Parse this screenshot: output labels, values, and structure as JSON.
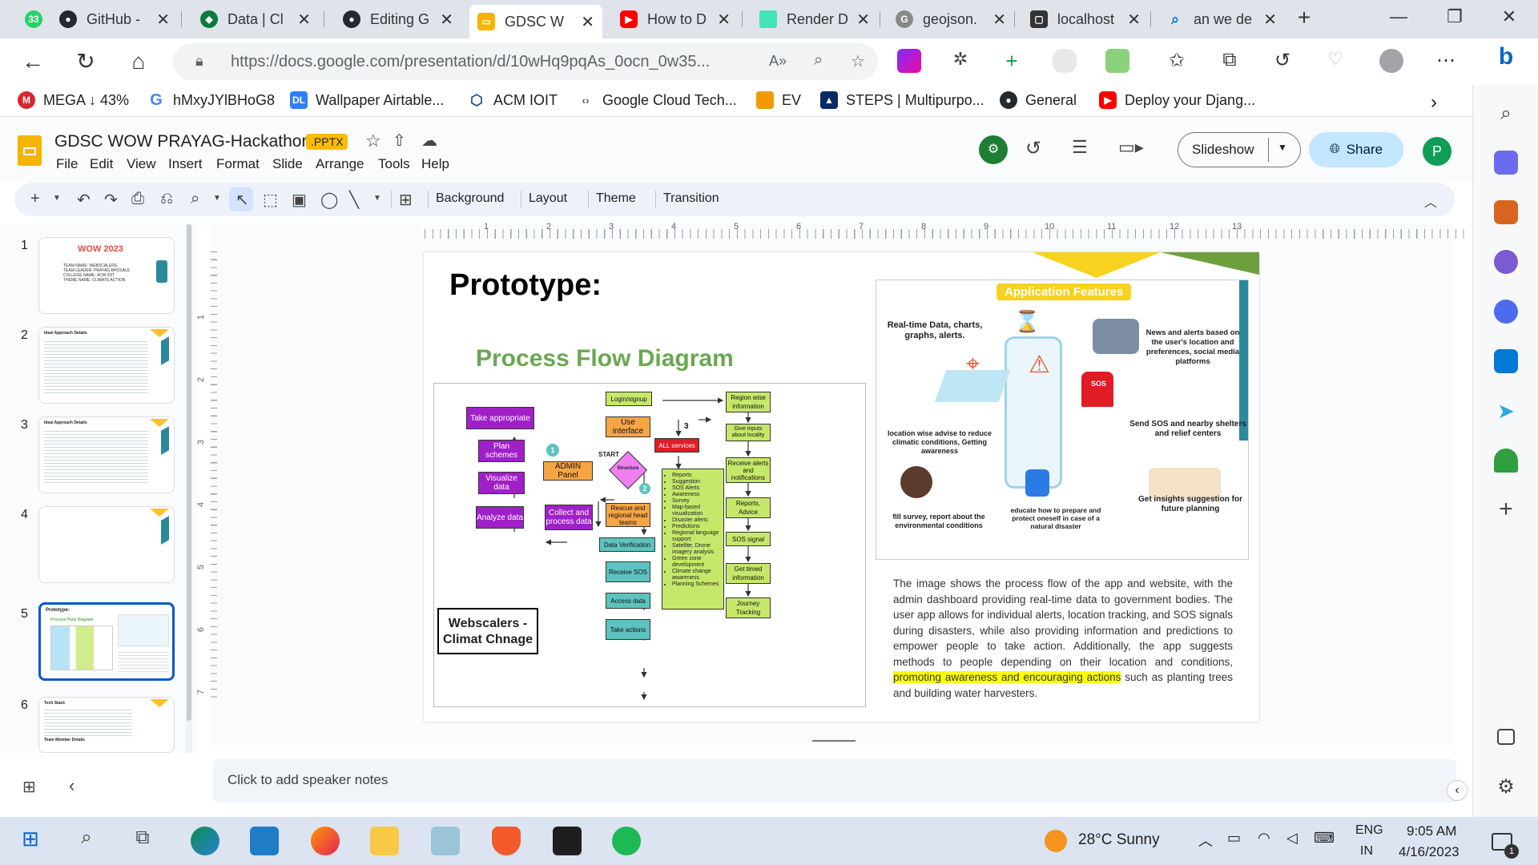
{
  "browser": {
    "tabs": [
      {
        "label": "33",
        "icon": "whatsapp-icon",
        "color": "#25d366"
      },
      {
        "label": "GitHub -",
        "icon": "github-icon",
        "color": "#24292f"
      },
      {
        "label": "Data | Cl",
        "icon": "dataset-icon",
        "color": "#0b7a3e"
      },
      {
        "label": "Editing G",
        "icon": "github-icon",
        "color": "#24292f"
      },
      {
        "label": "GDSC W",
        "icon": "slides-icon",
        "color": "#f4b400"
      },
      {
        "label": "How to D",
        "icon": "youtube-icon",
        "color": "#ff0000"
      },
      {
        "label": "Render D",
        "icon": "render-icon",
        "color": "#46e3b7"
      },
      {
        "label": "geojson.",
        "icon": "geojson-icon",
        "color": "#888888"
      },
      {
        "label": "localhost",
        "icon": "localhost-icon",
        "color": "#333333"
      },
      {
        "label": "an we de",
        "icon": "bing-search-icon",
        "color": "#0078d4"
      }
    ],
    "url": "https://docs.google.com/presentation/d/10wHq9pqAs_0ocn_0w35...",
    "bookmarks": [
      {
        "label": "MEGA ↓ 43%",
        "icon": "mega-icon",
        "color": "#d9272e"
      },
      {
        "label": "hMxyJYlBHoG8",
        "icon": "google-icon",
        "color": "#4285f4"
      },
      {
        "label": "Wallpaper Airtable...",
        "icon": "airtable-icon",
        "color": "#2d7ff9"
      },
      {
        "label": "ACM IOIT",
        "icon": "acm-icon",
        "color": "#1d4e89"
      },
      {
        "label": "Google Cloud Tech...",
        "icon": "gdsc-icon",
        "color": "#5f6368"
      },
      {
        "label": "EV",
        "icon": "ev-icon",
        "color": "#f29900"
      },
      {
        "label": "STEPS | Multipurpo...",
        "icon": "steps-icon",
        "color": "#0a2a66"
      },
      {
        "label": "General",
        "icon": "github-icon",
        "color": "#24292f"
      },
      {
        "label": "Deploy your Djang...",
        "icon": "youtube-icon",
        "color": "#ff0000"
      }
    ]
  },
  "slides_app": {
    "title": "GDSC WOW PRAYAG-Hackathon",
    "badge": ".PPTX",
    "menus": [
      "File",
      "Edit",
      "View",
      "Insert",
      "Format",
      "Slide",
      "Arrange",
      "Tools",
      "Help"
    ],
    "slideshow_label": "Slideshow",
    "share_label": "Share",
    "avatar_initial": "P",
    "toolbar_items": [
      "Background",
      "Layout",
      "Theme",
      "Transition"
    ],
    "speaker_notes_placeholder": "Click to add speaker notes",
    "ruler_h": [
      "1",
      "2",
      "3",
      "4",
      "5",
      "6",
      "7",
      "8",
      "9",
      "10",
      "11",
      "12",
      "13"
    ],
    "ruler_v": [
      "1",
      "2",
      "3",
      "4",
      "5",
      "6",
      "7"
    ]
  },
  "filmstrip": {
    "slides": [
      {
        "number": "1",
        "texts": [
          "WOW 2023",
          "TEAM NAME: WEBSCALERS",
          "TEAM LEADER: PRAYAG BHOSALE",
          "COLLEGE NAME: ACM IOIT",
          "THEME NAME: CLIMATE ACTION"
        ]
      },
      {
        "number": "2",
        "texts": [
          "Idea/ Approach Details"
        ]
      },
      {
        "number": "3",
        "texts": [
          "Idea/ Approach Details"
        ]
      },
      {
        "number": "4",
        "texts": []
      },
      {
        "number": "5",
        "texts": [
          "Prototype:",
          "Process Flow Diagram"
        ]
      },
      {
        "number": "6",
        "texts": [
          "Tech Stack",
          "Team Member Details"
        ]
      }
    ],
    "selected": "5"
  },
  "slide": {
    "heading": "Prototype:",
    "subheading": "Process Flow Diagram",
    "team_box": [
      "Webscalers -",
      "Climat Chnage"
    ],
    "flow": {
      "take_appropriate": "Take appropriate",
      "plan_schemes": "Plan schemes",
      "visualize_data": "Visualize data",
      "analyze_data": "Analyze data",
      "collect_process": "Collect and process data",
      "admin_panel": "ADMIN Panel",
      "login": "Login/signup",
      "use_interface": "Use interface",
      "start": "START",
      "structure": "Structure",
      "rescue": "Rescue and regional head teams",
      "data_verification": "Data Verification",
      "receive_sos": "Receive SOS",
      "access_data": "Access data",
      "take_actions": "Take actions",
      "all_services": "ALL services",
      "services_list": [
        "Reports",
        "Suggestion",
        "SOS Alerts",
        "Awareness",
        "Survey",
        "Map-based visualization",
        "Disaster alerts",
        "Predictions",
        "Regional language support",
        "Satellite, Drone imagery analysis",
        "Green zone development",
        "Climate change awareness",
        "Planning Schemes"
      ],
      "region_info": "Region wise information",
      "give_inputs": "Give inputs about locality",
      "receive_alerts": "Receive alerts and notifications",
      "reports_advice": "Reports, Advice",
      "sos_signal": "SOS signal",
      "timed_info": "Get timed information",
      "journey": "Journey Tracking",
      "markers": [
        "1",
        "2",
        "3"
      ]
    },
    "features": {
      "title": "Application Features",
      "realtime": "Real-time Data, charts, graphs, alerts.",
      "news": "News and alerts based on the user's location and preferences, social media platforms",
      "location": "location wise advise to reduce climatic conditions, Getting awareness",
      "sos": "Send SOS and nearby shelters and relief centers",
      "sos_badge": "SOS",
      "survey": "fill survey, report about the environmental conditions",
      "educate": "educate how to prepare and protect oneself in case of a natural disaster",
      "insights": "Get insights suggestion for future planning"
    },
    "description_before": "The image shows the process flow of the app and website, with the admin dashboard providing real-time data to government bodies. The user app allows for individual alerts, location tracking, and SOS signals during disasters, while also providing information and predictions to empower people to take action. Additionally, the app suggests methods to people depending on their location and conditions,",
    "description_highlight": "promoting awareness and encouraging actions",
    "description_after": "such as planting trees and building water harvesters."
  },
  "taskbar": {
    "weather": "28°C  Sunny",
    "lang_top": "ENG",
    "lang_bottom": "IN",
    "time": "9:05 AM",
    "date": "4/16/2023",
    "notifications": "1"
  }
}
